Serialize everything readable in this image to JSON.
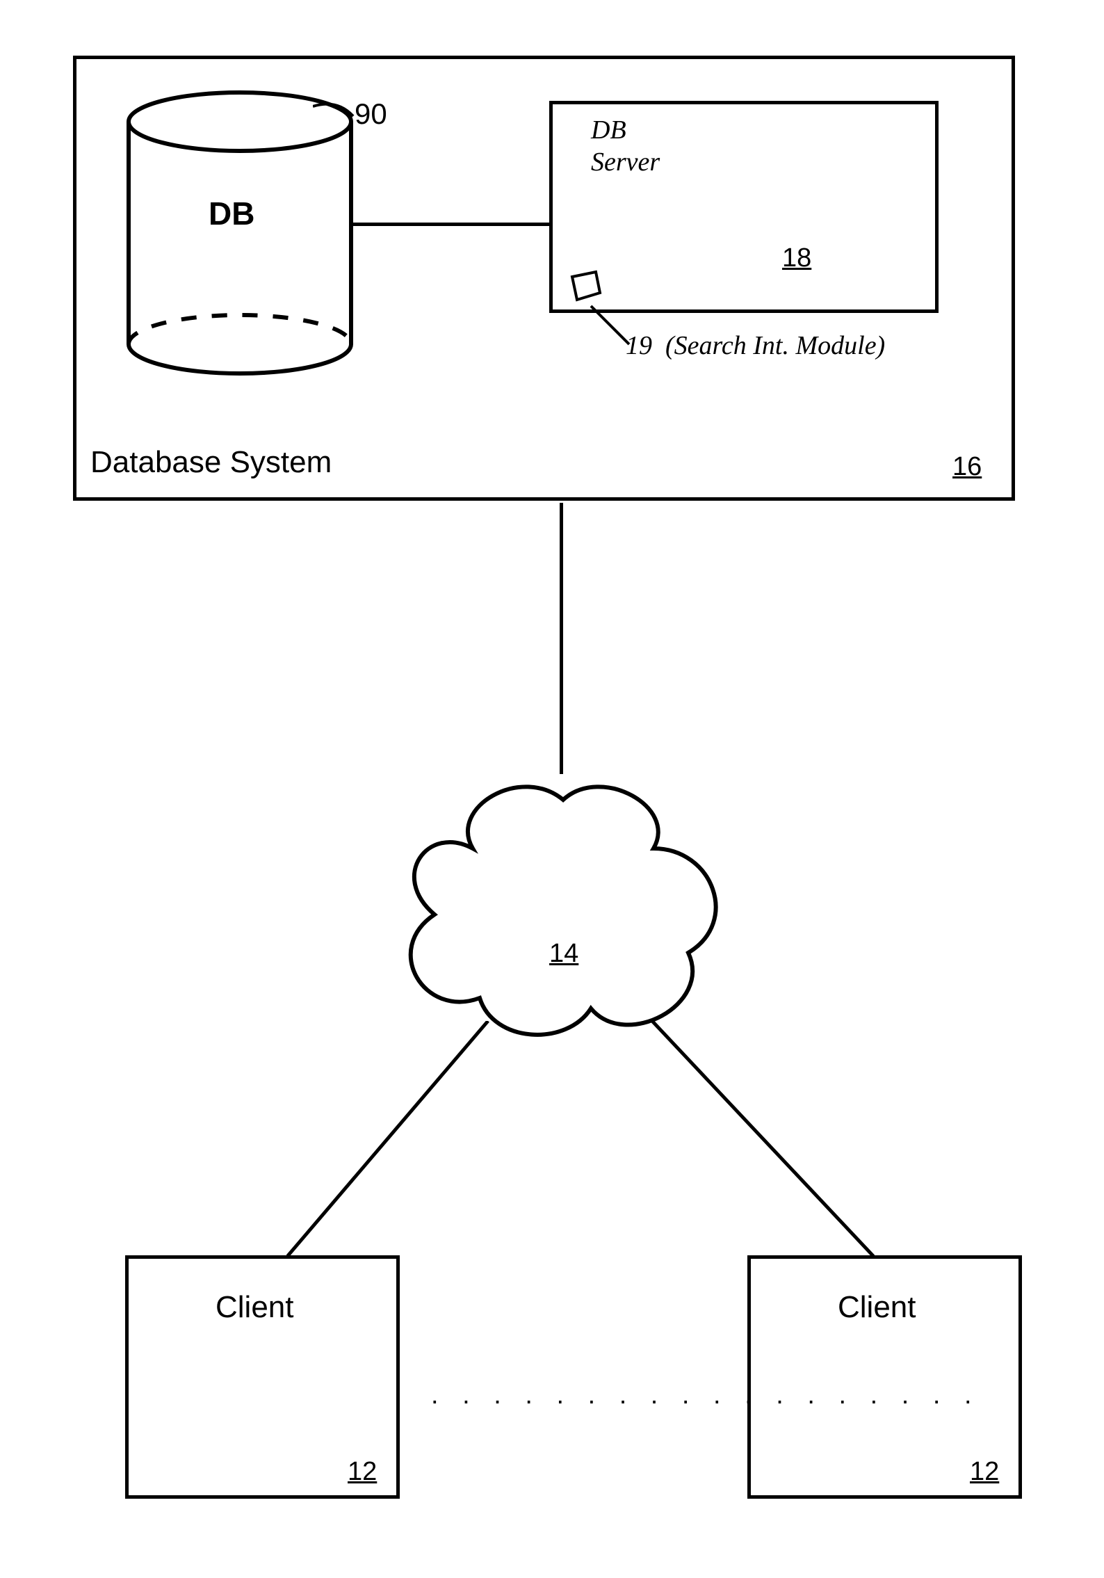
{
  "system": {
    "title": "Database System",
    "ref": "16",
    "db": {
      "label": "DB",
      "ref": "90"
    },
    "server": {
      "label_line1": "DB",
      "label_line2": "Server",
      "ref": "18",
      "module": {
        "ref": "19",
        "description": "(Search Int. Module)"
      }
    }
  },
  "network": {
    "ref": "14"
  },
  "clients": {
    "label": "Client",
    "ref": "12",
    "ellipsis": ". . . . . . . . . . . . . . . . . ."
  }
}
